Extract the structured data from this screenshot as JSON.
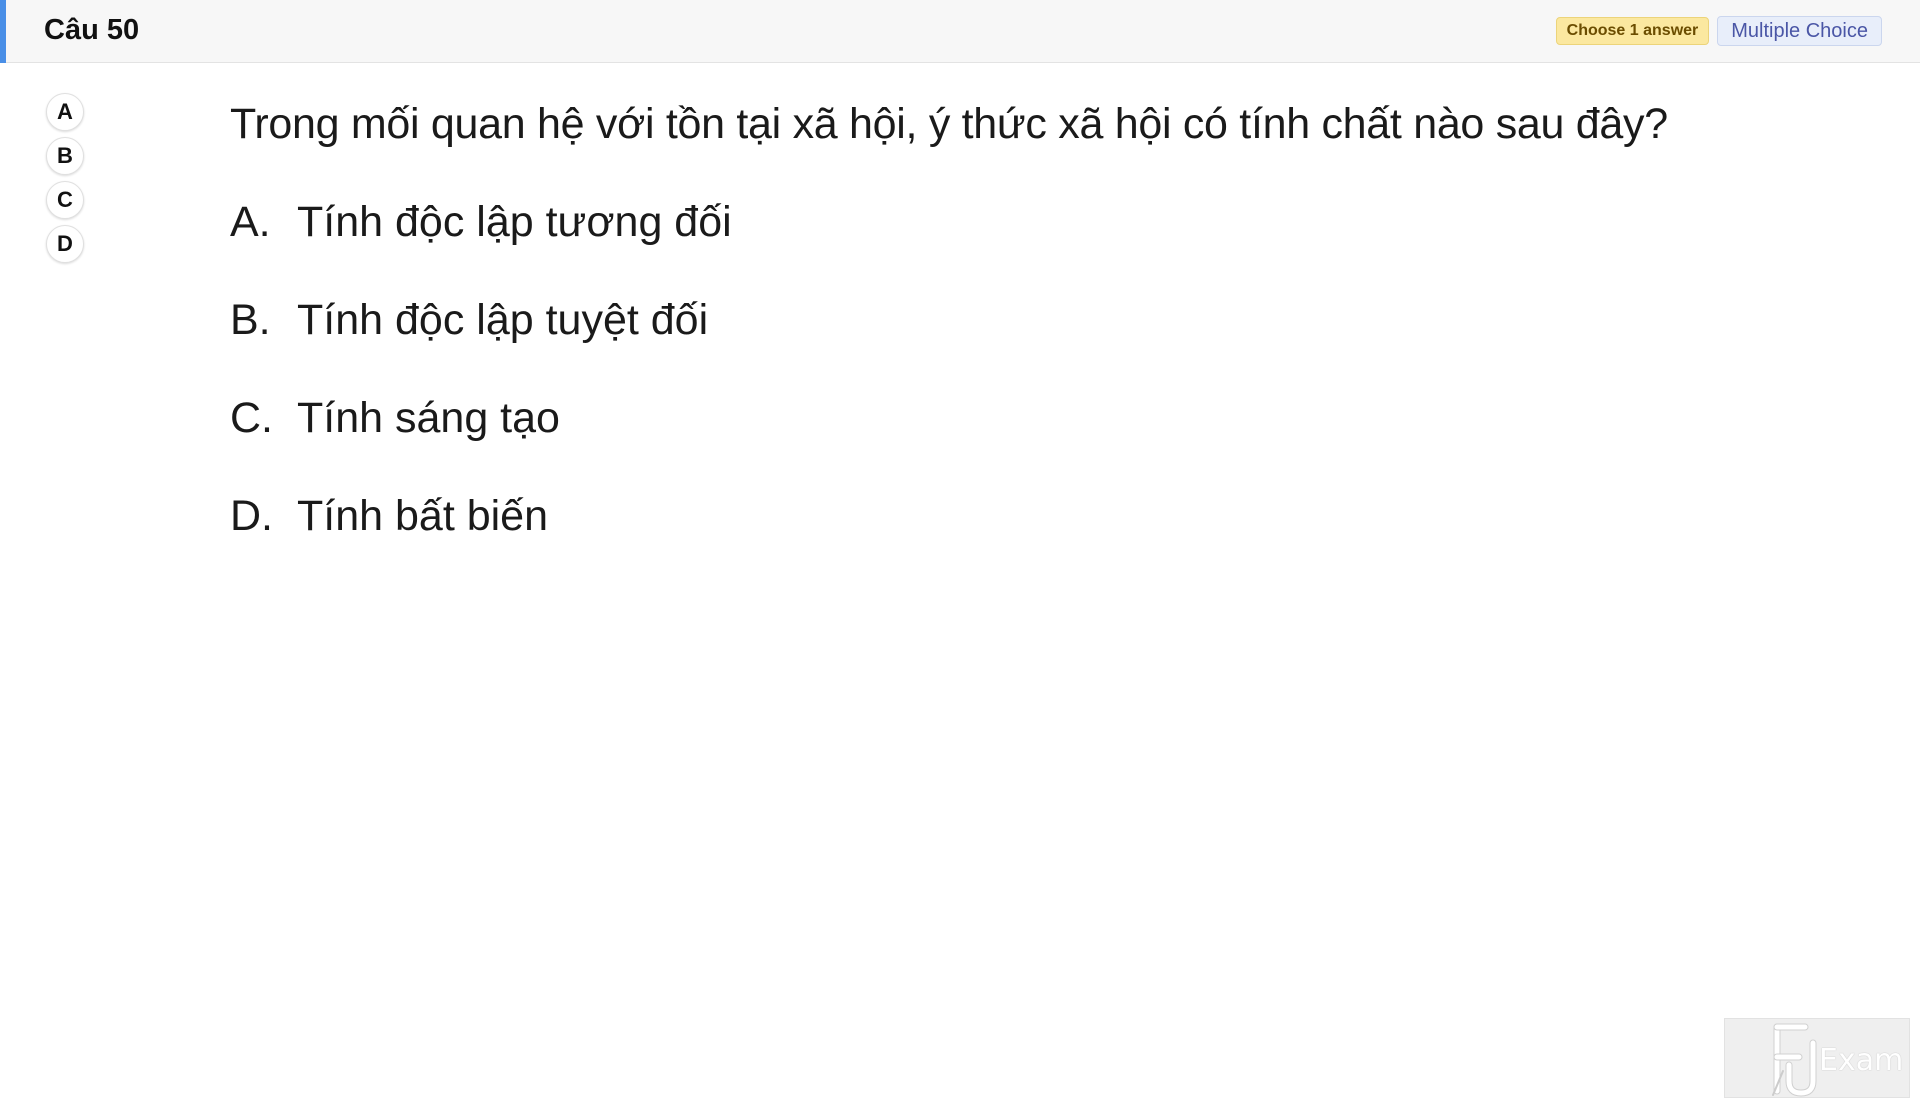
{
  "header": {
    "question_title": "Câu 50",
    "badge_choose": "Choose 1 answer",
    "badge_type": "Multiple Choice",
    "accent_color": "#4a8fe7"
  },
  "answer_pad": {
    "buttons": [
      "A",
      "B",
      "C",
      "D"
    ]
  },
  "question": {
    "text": "Trong mối quan hệ với tồn tại xã hội, ý thức xã hội có tính chất nào sau đây?",
    "options": [
      {
        "letter": "A.",
        "text": "Tính độc lập tương đối"
      },
      {
        "letter": "B.",
        "text": "Tính độc lập tuyệt đối"
      },
      {
        "letter": "C.",
        "text": "Tính sáng tạo"
      },
      {
        "letter": "D.",
        "text": "Tính bất biến"
      }
    ]
  },
  "watermark": {
    "text": "Exam",
    "icon": "fu-logo-icon"
  }
}
